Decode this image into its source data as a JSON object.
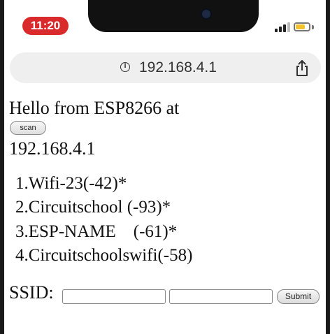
{
  "status_bar": {
    "time": "11:20",
    "battery_level": 0.7,
    "signal_bars": 3
  },
  "browser": {
    "url": "192.168.4.1",
    "info_icon": "info-icon",
    "share_icon": "share-icon"
  },
  "page": {
    "heading": "Hello from ESP8266 at",
    "scan_label": "scan",
    "ip": "192.168.4.1",
    "networks": [
      "1.Wifi-23(-42)*",
      "2.Circuitschool (-93)*",
      "3.ESP-NAME    (-61)*",
      "4.Circuitschoolswifi(-58)"
    ],
    "ssid_label": "SSID:",
    "ssid_value": "",
    "password_value": "",
    "submit_label": "Submit"
  },
  "colors": {
    "time_pill": "#d92b2b",
    "battery_fill": "#f2c12e",
    "url_bar_bg": "#efefef"
  }
}
